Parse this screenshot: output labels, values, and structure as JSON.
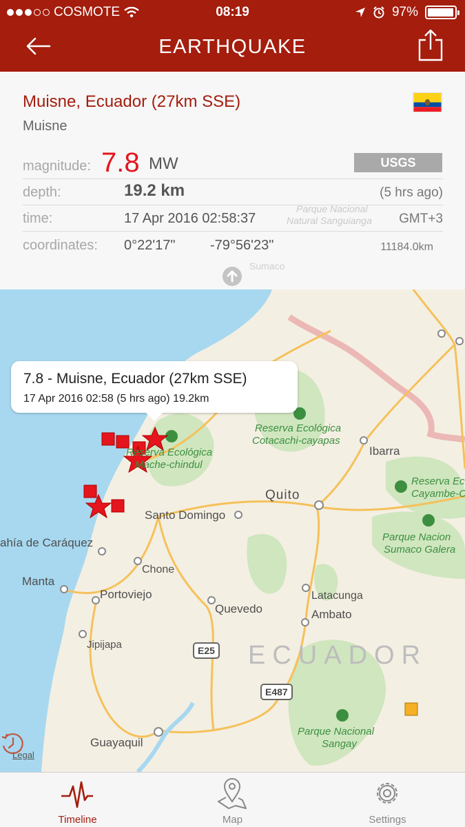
{
  "status_bar": {
    "carrier": "COSMOTE",
    "time": "08:19",
    "battery": "97%",
    "signal_bars_filled": 3,
    "signal_bars_total": 5
  },
  "nav": {
    "title": "EARTHQUAKE",
    "back_icon": "arrow-left-icon",
    "share_icon": "share-icon"
  },
  "quake": {
    "place": "Muisne, Ecuador (27km SSE)",
    "subplace": "Muisne",
    "flag_country": "Ecuador",
    "magnitude_label": "magnitude:",
    "magnitude_value": "7.8",
    "magnitude_unit": "MW",
    "source": "USGS",
    "depth_label": "depth:",
    "depth_value": "19.2 km",
    "ago": "(5 hrs ago)",
    "time_label": "time:",
    "time_value": "17 Apr 2016 02:58:37",
    "timezone": "GMT+3",
    "coord_label": "coordinates:",
    "coord_lat": "0°22'17\"",
    "coord_lon": "-79°56'23\"",
    "distance": "11184.0km"
  },
  "map": {
    "callout_title": "7.8 - Muisne, Ecuador (27km SSE)",
    "callout_detail": "17 Apr 2016 02:58 (5 hrs ago) 19.2km",
    "country_label": "ECUADOR",
    "legal": "Legal",
    "cities": {
      "quito": "Quito",
      "ibarra": "Ibarra",
      "santo_domingo": "Santo Domingo",
      "bahia": "ahía de Caráquez",
      "chone": "Chone",
      "manta": "Manta",
      "portoviejo": "Portoviejo",
      "quevedo": "Quevedo",
      "latacunga": "Latacunga",
      "ambato": "Ambato",
      "jipijapa": "Jipijapa",
      "guayaquil": "Guayaquil"
    },
    "parks": {
      "mache_1": "Reserva Ecológica",
      "mache_2": "Mache-chindul",
      "cotacachi_1": "Reserva Ecológica",
      "cotacachi_2": "Cotacachi-cayapas",
      "cayambe_1": "Reserva Ec",
      "cayambe_2": "Cayambe-C",
      "sumaco_1": "Parque Nacion",
      "sumaco_2": "Sumaco Galera",
      "sangay_1": "Parque Nacional",
      "sangay_2": "Sangay"
    },
    "background_labels": {
      "sangui_1": "Parque Nacional",
      "sangui_2": "Natural Sanguianga",
      "sumaco_small": "Sumaco"
    },
    "highways": {
      "e25": "E25",
      "e487": "E487"
    },
    "colors": {
      "sea": "#a7d8f0",
      "land": "#f4efe3",
      "park": "#cfe6bf",
      "road": "#f5c15a",
      "border": "#e8a6a6",
      "marker": "#e5151d",
      "older_marker": "#f6b026"
    }
  },
  "tabs": [
    {
      "label": "Timeline",
      "icon": "pulse-icon",
      "active": true
    },
    {
      "label": "Map",
      "icon": "map-pin-icon",
      "active": false
    },
    {
      "label": "Settings",
      "icon": "gear-icon",
      "active": false
    }
  ],
  "colors": {
    "brand": "#a41d0d",
    "magnitude": "#e5151d",
    "source_badge": "#a9a9a9"
  }
}
